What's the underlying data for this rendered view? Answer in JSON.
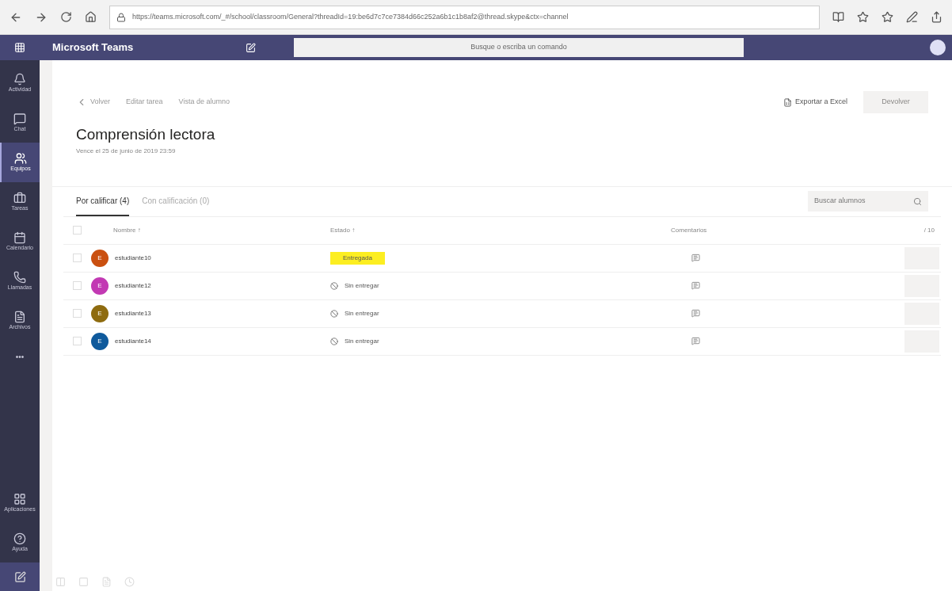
{
  "browser": {
    "url": "https://teams.microsoft.com/_#/school/classroom/General?threadId=19:be6d7c7ce7384d66c252a6b1c1b8af2@thread.skype&ctx=channel"
  },
  "app": {
    "title": "Microsoft Teams",
    "search_placeholder": "Busque o escriba un comando"
  },
  "rail": [
    {
      "label": "Actividad",
      "selected": false
    },
    {
      "label": "Chat",
      "selected": false
    },
    {
      "label": "Equipos",
      "selected": true
    },
    {
      "label": "Tareas",
      "selected": false
    },
    {
      "label": "Calendario",
      "selected": false
    },
    {
      "label": "Llamadas",
      "selected": false
    },
    {
      "label": "Archivos",
      "selected": false
    }
  ],
  "rail_more": "•••",
  "rail_bottom": [
    {
      "label": "Aplicaciones",
      "selected": false
    },
    {
      "label": "Ayuda",
      "selected": false
    }
  ],
  "page": {
    "back": "Volver",
    "links": [
      "Editar tarea",
      "Vista de alumno"
    ],
    "title": "Comprensión lectora",
    "due": "Vence el 25 de junio de 2019 23:59",
    "export": "Exportar a Excel",
    "return_button": "Devolver"
  },
  "tabs": [
    {
      "label": "Por calificar (4)",
      "selected": true
    },
    {
      "label": "Con calificación (0)",
      "selected": false
    }
  ],
  "search": {
    "placeholder": "Buscar alumnos"
  },
  "select_all": {
    "checked": false
  },
  "columns": [
    "Nombre ↑",
    "Estado ↑",
    "Comentarios",
    "/ 10"
  ],
  "rows": [
    {
      "name": "estudiante10",
      "initial": "E",
      "color": "#ca5010",
      "status": "Entregada",
      "kind": "submitted",
      "checked": false
    },
    {
      "name": "estudiante12",
      "initial": "E",
      "color": "#c239b3",
      "status": "Sin entregar",
      "kind": "missing",
      "checked": false
    },
    {
      "name": "estudiante13",
      "initial": "E",
      "color": "#8e6b0f",
      "status": "Sin entregar",
      "kind": "missing",
      "checked": false
    },
    {
      "name": "estudiante14",
      "initial": "E",
      "color": "#0f5a9c",
      "status": "Sin entregar",
      "kind": "missing",
      "checked": false
    }
  ]
}
